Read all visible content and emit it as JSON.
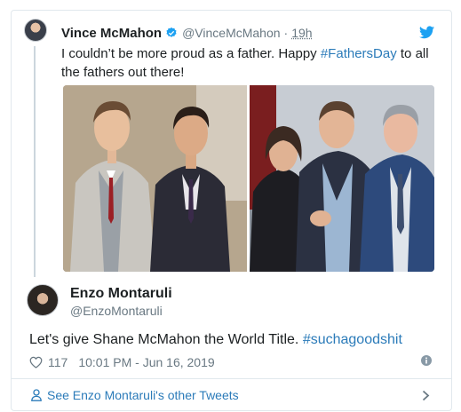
{
  "parent_tweet": {
    "author_name": "Vince McMahon",
    "handle": "@VinceMcMahon",
    "separator": "·",
    "time": "19h",
    "text_before": "I couldn’t be more proud as a father. Happy ",
    "hashtag": "#FathersDay",
    "text_after": " to all the fathers out there!"
  },
  "reply_tweet": {
    "author_name": "Enzo Montaruli",
    "handle": "@EnzoMontaruli",
    "text_before": "Let's give Shane McMahon the World Title. ",
    "hashtag": "#suchagoodshit",
    "likes": "117",
    "timestamp": "10:01 PM - Jun 16, 2019"
  },
  "footer": {
    "see_more": "See Enzo Montaruli's other Tweets"
  },
  "colors": {
    "link": "#2b7bb9",
    "muted": "#697882",
    "border": "#e1e8ed",
    "twitter_blue": "#1da1f2"
  },
  "icons": [
    "verified-badge-icon",
    "twitter-bird-icon",
    "heart-icon",
    "info-icon",
    "person-icon",
    "chevron-right-icon"
  ]
}
